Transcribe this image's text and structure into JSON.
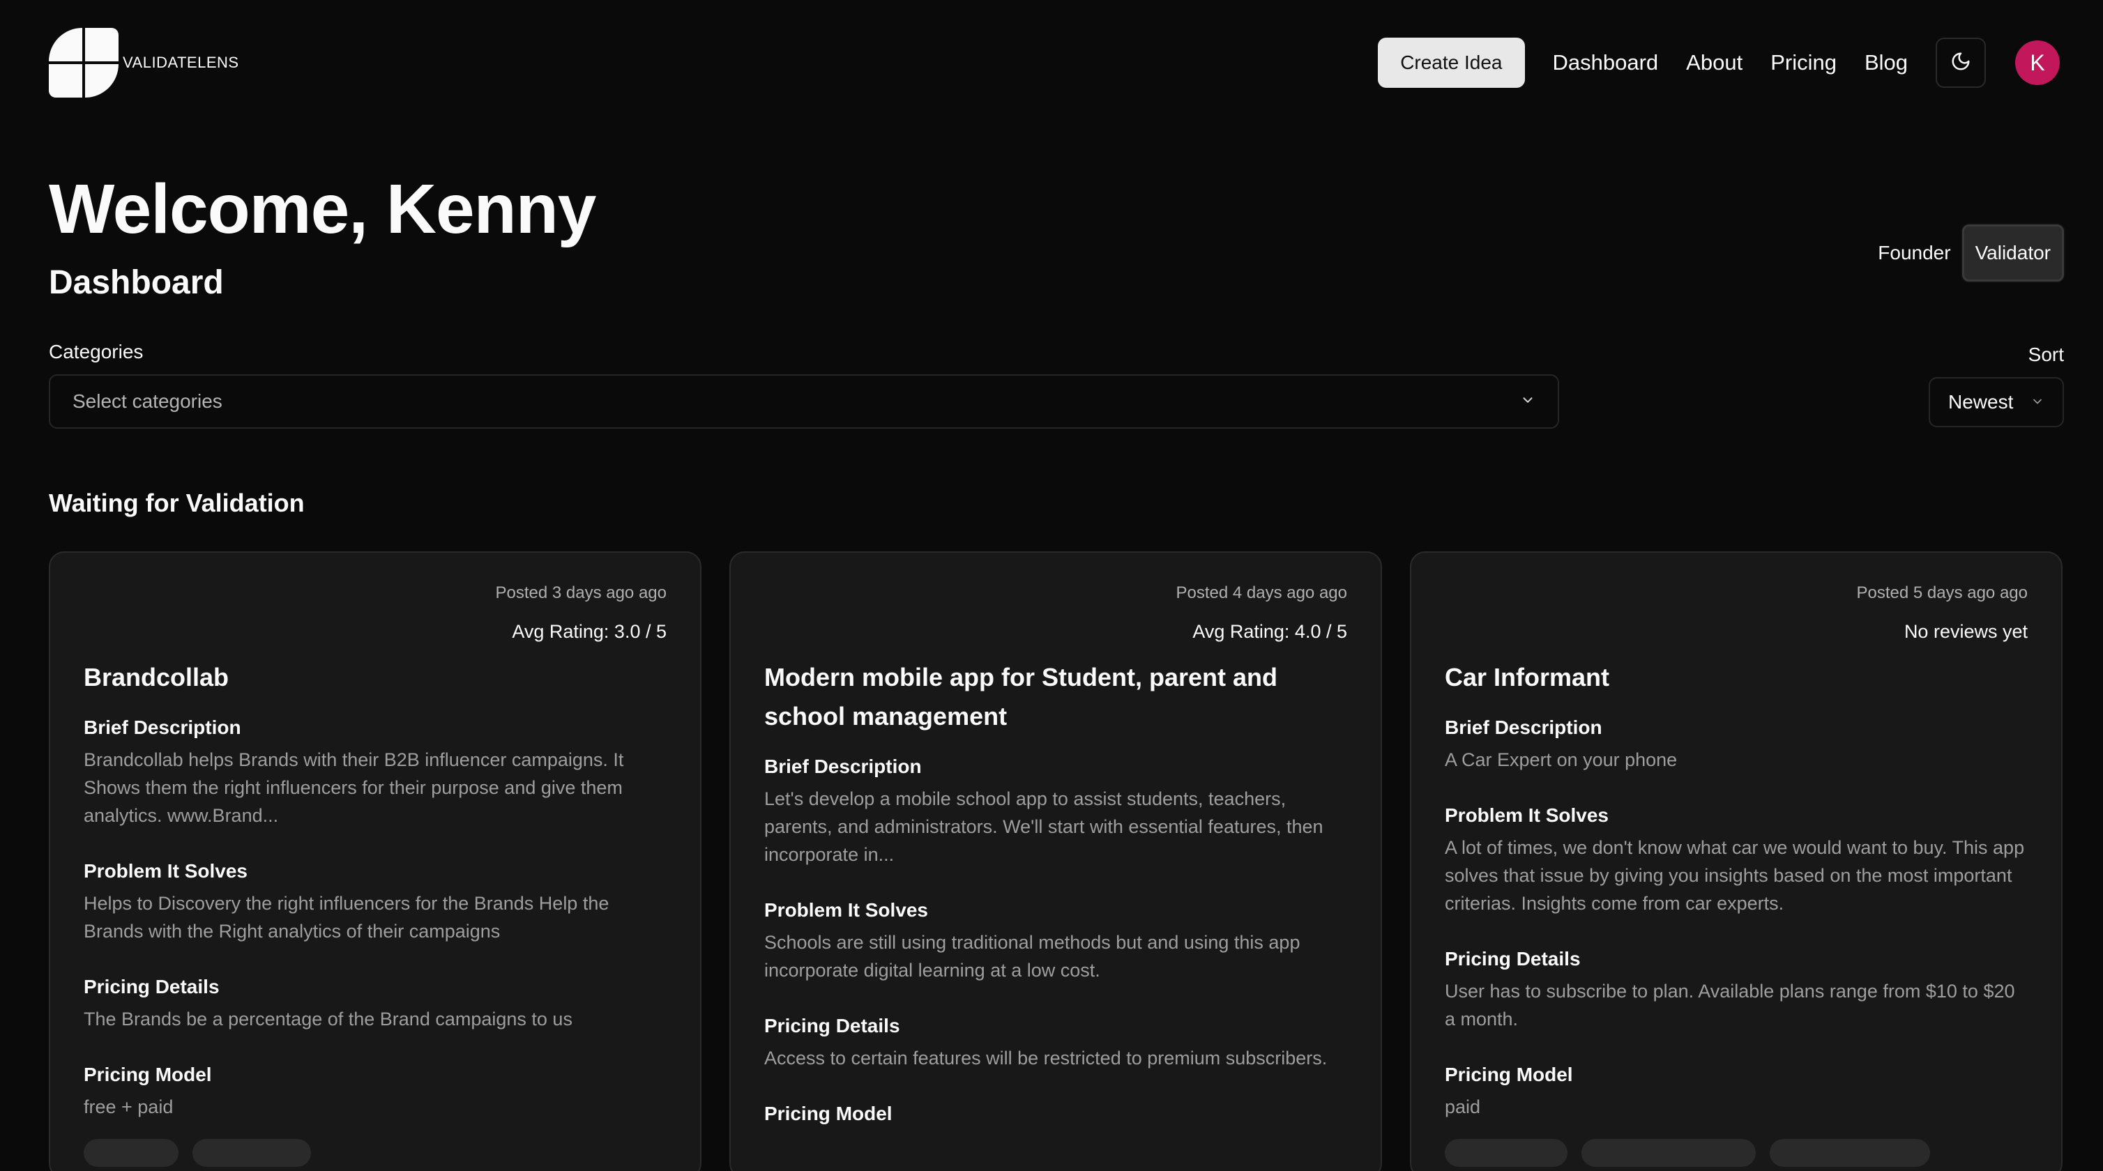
{
  "brand": {
    "name": "VALIDATELENS",
    "logo_icon": "validatelens-logo-icon"
  },
  "nav": {
    "create_label": "Create Idea",
    "links": [
      "Dashboard",
      "About",
      "Pricing",
      "Blog"
    ],
    "theme_icon": "moon-icon",
    "avatar_initial": "K",
    "avatar_color": "#c2185b"
  },
  "welcome": {
    "title": "Welcome, Kenny",
    "subtitle": "Dashboard"
  },
  "role_toggle": {
    "options": [
      "Founder",
      "Validator"
    ],
    "selected": "Validator"
  },
  "filters": {
    "categories_label": "Categories",
    "categories_placeholder": "Select categories",
    "sort_label": "Sort",
    "sort_value": "Newest"
  },
  "section": {
    "title": "Waiting for Validation"
  },
  "cards": [
    {
      "posted": "Posted 3 days ago ago",
      "rating": "Avg Rating: 3.0 / 5",
      "title": "Brandcollab",
      "brief_label": "Brief Description",
      "brief": "Brandcollab helps Brands with their B2B influencer campaigns. It Shows them the right influencers for their purpose and give them analytics. www.Brand...",
      "problem_label": "Problem It Solves",
      "problem": "Helps to Discovery the right influencers for the Brands Help the Brands with the Right analytics of their campaigns",
      "pricing_details_label": "Pricing Details",
      "pricing_details": "The Brands be a percentage of the Brand campaigns to us",
      "pricing_model_label": "Pricing Model",
      "pricing_model": "free + paid"
    },
    {
      "posted": "Posted 4 days ago ago",
      "rating": "Avg Rating: 4.0 / 5",
      "title": "Modern mobile app for Student, parent and school management",
      "brief_label": "Brief Description",
      "brief": "Let's develop a mobile school app to assist students, teachers, parents, and administrators. We'll start with essential features, then incorporate in...",
      "problem_label": "Problem It Solves",
      "problem": "Schools are still using traditional methods but and using this app incorporate digital learning at a low cost.",
      "pricing_details_label": "Pricing Details",
      "pricing_details": "Access to certain features will be restricted to premium subscribers.",
      "pricing_model_label": "Pricing Model",
      "pricing_model": ""
    },
    {
      "posted": "Posted 5 days ago ago",
      "rating": "No reviews yet",
      "title": "Car Informant",
      "brief_label": "Brief Description",
      "brief": "A Car Expert on your phone",
      "problem_label": "Problem It Solves",
      "problem": "A lot of times, we don't know what car we would want to buy. This app solves that issue by giving you insights based on the most important criterias. Insights come from car experts.",
      "pricing_details_label": "Pricing Details",
      "pricing_details": "User has to subscribe to plan. Available plans range from $10 to $20 a month.",
      "pricing_model_label": "Pricing Model",
      "pricing_model": "paid"
    }
  ]
}
